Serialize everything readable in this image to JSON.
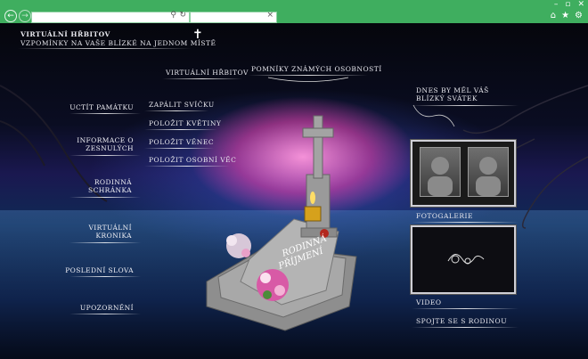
{
  "browser": {
    "back_icon": "back-arrow-icon",
    "forward_icon": "forward-arrow-icon",
    "address_icons": [
      "search-icon",
      "refresh-icon"
    ],
    "tab_close": "×",
    "tools": [
      "home-icon",
      "star-icon",
      "gear-icon"
    ]
  },
  "header": {
    "title": "VIRTUÁLNÍ HŘBITOV",
    "subtitle": "VZPOMÍNKY NA VAŠE BLÍZKÉ NA JEDNOM MÍSTĚ",
    "cross": "✝"
  },
  "top_nav": {
    "virtual_cemetery": "VIRTUÁLNÍ HŘBITOV",
    "famous_monuments": "Pomníky známých osobností"
  },
  "left_menu": [
    {
      "label": "UCTÍT PAMÁTKU"
    },
    {
      "label": "INFORMACE O ZESNULÝCH"
    },
    {
      "label": "RODINNÁ SCHRÁNKA"
    },
    {
      "label": "VIRTUÁLNÍ KRONIKA"
    },
    {
      "label": "Poslední slova"
    },
    {
      "label": "UPOZORNĚNÍ"
    }
  ],
  "submenu": [
    {
      "label": "ZAPÁLIT SVÍČKU"
    },
    {
      "label": "POLOŽIT KVĚTINY"
    },
    {
      "label": "POLOŽIT VĚNEC"
    },
    {
      "label": "POLOŽIT OSOBNÍ VĚC"
    }
  ],
  "right_panel": {
    "birthday": "DNES BY MĚL VÁŠ BLÍZKÝ SVÁTEK",
    "gallery": "FOTOGALERIE",
    "video": "VIDEO",
    "contact": "SPOJTE SE S RODINOU"
  },
  "grave": {
    "inscription": "RODINNÁ PŘÍJMENÍ"
  },
  "colors": {
    "chrome": "#3fae5f",
    "text": "#f0f0f5",
    "accent_pink": "#e85cc0"
  }
}
